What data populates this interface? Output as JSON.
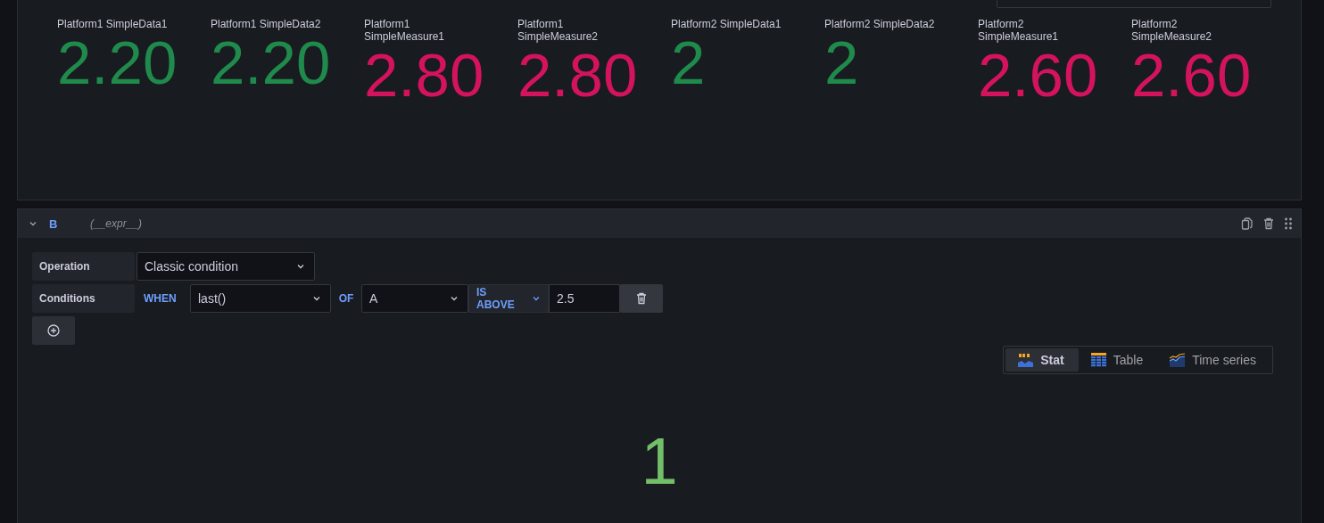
{
  "stats": [
    {
      "name": "Platform1 SimpleData1",
      "value": "2.20",
      "color": "#1f8a4c"
    },
    {
      "name": "Platform1 SimpleData2",
      "value": "2.20",
      "color": "#1f8a4c"
    },
    {
      "name": "Platform1\nSimpleMeasure1",
      "value": "2.80",
      "color": "#d4135e"
    },
    {
      "name": "Platform1\nSimpleMeasure2",
      "value": "2.80",
      "color": "#d4135e"
    },
    {
      "name": "Platform2 SimpleData1",
      "value": "2",
      "color": "#1f8a4c"
    },
    {
      "name": "Platform2 SimpleData2",
      "value": "2",
      "color": "#1f8a4c"
    },
    {
      "name": "Platform2\nSimpleMeasure1",
      "value": "2.60",
      "color": "#d4135e"
    },
    {
      "name": "Platform2\nSimpleMeasure2",
      "value": "2.60",
      "color": "#d4135e"
    }
  ],
  "query": {
    "ref": "B",
    "type": "(__expr__)",
    "expanded": true,
    "operation_label": "Operation",
    "operation": "Classic condition",
    "conditions_label": "Conditions",
    "when": "WHEN",
    "reducer": "last()",
    "of": "OF",
    "query": "A",
    "evaluator": "IS ABOVE",
    "threshold": "2.5"
  },
  "views": [
    {
      "label": "Stat",
      "kind": "stat",
      "selected": true
    },
    {
      "label": "Table",
      "kind": "table",
      "selected": false
    },
    {
      "label": "Time series",
      "kind": "timeseries",
      "selected": false
    }
  ],
  "result": {
    "value": "1",
    "color": "#73bf69"
  }
}
